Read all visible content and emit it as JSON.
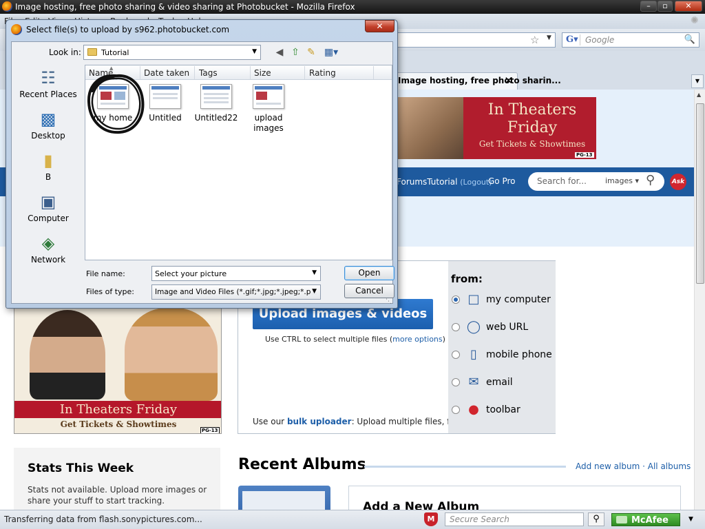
{
  "window": {
    "title": "Image hosting, free photo sharing & video sharing at Photobucket - Mozilla Firefox",
    "menu": [
      "File",
      "Edit",
      "View",
      "History",
      "Bookmarks",
      "Tools",
      "Help"
    ]
  },
  "toolbar": {
    "search_placeholder": "Google",
    "tab_title": "Image hosting, free photo sharin..."
  },
  "page": {
    "ad_top": {
      "line1": "In Theaters",
      "line2": "Friday",
      "line3": "Get Tickets & Showtimes",
      "rating": "PG-13"
    },
    "nav": {
      "user": "ForumsTutorial",
      "logout": "(Logout)",
      "gopro": "Go Pro",
      "search_placeholder": "Search for...",
      "search_scope": "images ▾",
      "ask": "Ask"
    },
    "ad_left": {
      "band": "In Theaters Friday",
      "sub": "Get Tickets & Showtimes",
      "rating": "PG-13"
    },
    "upload": {
      "button": "Upload images & videos",
      "hint_prefix": "Use CTRL to select multiple files (",
      "hint_link": "more options",
      "hint_suffix": ")",
      "bulk_prefix": "Use our ",
      "bulk_link": "bulk uploader",
      "bulk_suffix": ": Upload multiple files, fast!",
      "from_label": "from:",
      "options": [
        {
          "label": "my computer",
          "icon": "laptop-icon",
          "selected": true
        },
        {
          "label": "web URL",
          "icon": "globe-icon",
          "selected": false
        },
        {
          "label": "mobile phone",
          "icon": "phone-icon",
          "selected": false
        },
        {
          "label": "email",
          "icon": "envelope-icon",
          "selected": false
        },
        {
          "label": "toolbar",
          "icon": "ask-icon",
          "selected": false
        }
      ]
    },
    "stats": {
      "heading": "Stats This Week",
      "text": "Stats not available. Upload more images or share your stuff to start tracking."
    },
    "recent": {
      "heading": "Recent Albums",
      "add_link": "Add new album",
      "sep": "·",
      "all_link": "All albums",
      "add_heading": "Add a New Album"
    }
  },
  "statusbar": {
    "text": "Transferring data from flash.sonypictures.com...",
    "secure_search_placeholder": "Secure Search",
    "mcafee": "McAfee"
  },
  "dialog": {
    "title": "Select file(s) to upload by s962.photobucket.com",
    "lookin_label": "Look in:",
    "lookin_value": "Tutorial",
    "places": [
      {
        "label": "Recent Places",
        "icon": "recent-places-icon"
      },
      {
        "label": "Desktop",
        "icon": "desktop-icon"
      },
      {
        "label": "B",
        "icon": "user-folder-icon"
      },
      {
        "label": "Computer",
        "icon": "computer-icon"
      },
      {
        "label": "Network",
        "icon": "network-icon"
      }
    ],
    "columns": [
      "Name",
      "Date taken",
      "Tags",
      "Size",
      "Rating"
    ],
    "files": [
      "my home",
      "Untitled",
      "Untitled22",
      "upload images"
    ],
    "filename_label": "File name:",
    "filename_value": "Select your picture",
    "filetype_label": "Files of type:",
    "filetype_value": "Image and Video Files (*.gif;*.jpg;*.jpeg;*.png;*.bmp)",
    "open": "Open",
    "cancel": "Cancel"
  }
}
